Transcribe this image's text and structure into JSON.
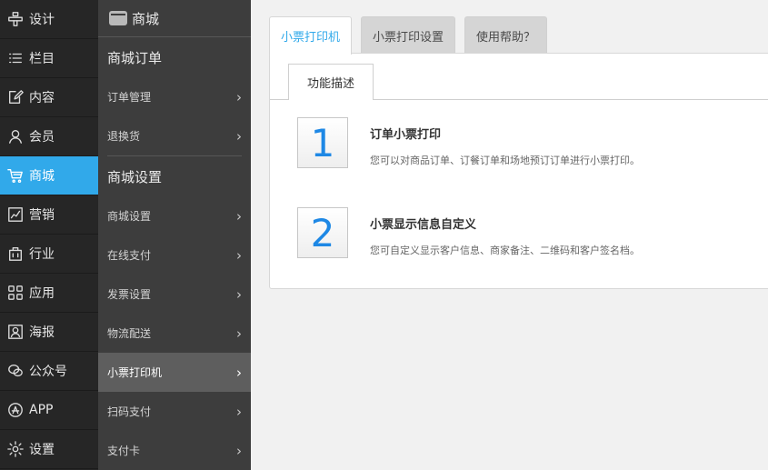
{
  "nav_primary": [
    {
      "label": "设计",
      "icon": "design-icon",
      "active": false
    },
    {
      "label": "栏目",
      "icon": "list-icon",
      "active": false
    },
    {
      "label": "内容",
      "icon": "edit-icon",
      "active": false
    },
    {
      "label": "会员",
      "icon": "user-icon",
      "active": false
    },
    {
      "label": "商城",
      "icon": "cart-icon",
      "active": true
    },
    {
      "label": "营销",
      "icon": "chart-icon",
      "active": false
    },
    {
      "label": "行业",
      "icon": "briefcase-icon",
      "active": false
    },
    {
      "label": "应用",
      "icon": "apps-icon",
      "active": false
    },
    {
      "label": "海报",
      "icon": "poster-icon",
      "active": false
    },
    {
      "label": "公众号",
      "icon": "wechat-icon",
      "active": false
    },
    {
      "label": "APP",
      "icon": "app-store-icon",
      "active": false
    },
    {
      "label": "设置",
      "icon": "gear-icon",
      "active": false
    }
  ],
  "nav_secondary": {
    "header": "商城",
    "section_orders": "商城订单",
    "order_items": [
      "订单管理",
      "退换货"
    ],
    "section_settings": "商城设置",
    "settings_items": [
      "商城设置",
      "在线支付",
      "发票设置",
      "物流配送",
      "小票打印机",
      "扫码支付",
      "支付卡"
    ],
    "active_item": "小票打印机"
  },
  "tabs": [
    "小票打印机",
    "小票打印设置",
    "使用帮助？"
  ],
  "active_tab": "小票打印机",
  "subtab": "功能描述",
  "features": [
    {
      "num": "1",
      "title": "订单小票打印",
      "desc": "您可以对商品订单、订餐订单和场地预订订单进行小票打印。"
    },
    {
      "num": "2",
      "title": "小票显示信息自定义",
      "desc": "您可自定义显示客户信息、商家备注、二维码和客户签名档。"
    }
  ],
  "colors": {
    "accent": "#31a9ea",
    "sidebar_bg": "#262626",
    "subnav_bg": "#3d3d3d",
    "number": "#1e88e5"
  }
}
